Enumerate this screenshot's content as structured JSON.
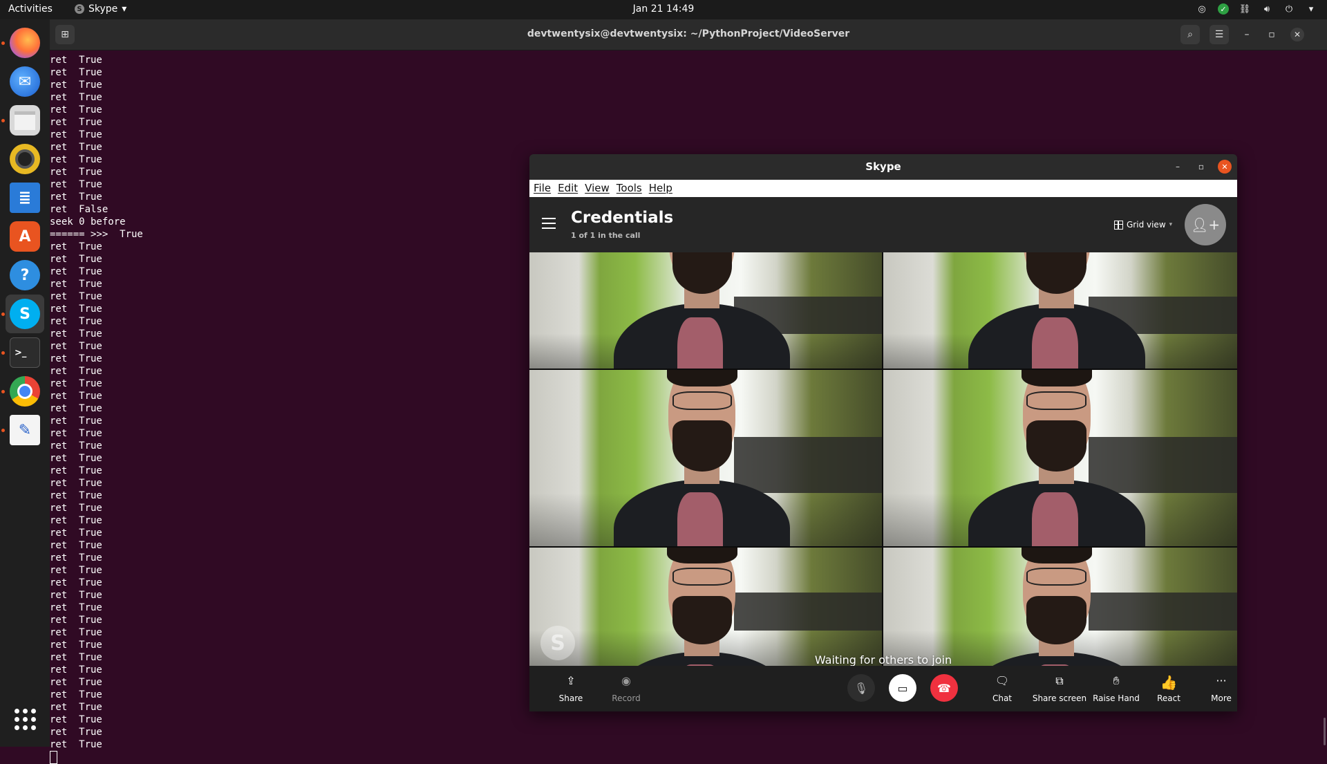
{
  "topbar": {
    "activities": "Activities",
    "app_name": "Skype",
    "clock": "Jan 21  14:49"
  },
  "terminal": {
    "title": "devtwentysix@devtwentysix: ~/PythonProject/VideoServer",
    "lines": [
      "ret  True",
      "ret  True",
      "ret  True",
      "ret  True",
      "ret  True",
      "ret  True",
      "ret  True",
      "ret  True",
      "ret  True",
      "ret  True",
      "ret  True",
      "ret  True",
      "ret  False",
      "seek 0 before",
      "====== >>>  True",
      "ret  True",
      "ret  True",
      "ret  True",
      "ret  True",
      "ret  True",
      "ret  True",
      "ret  True",
      "ret  True",
      "ret  True",
      "ret  True",
      "ret  True",
      "ret  True",
      "ret  True",
      "ret  True",
      "ret  True",
      "ret  True",
      "ret  True",
      "ret  True",
      "ret  True",
      "ret  True",
      "ret  True",
      "ret  True",
      "ret  True",
      "ret  True",
      "ret  True",
      "ret  True",
      "ret  True",
      "ret  True",
      "ret  True",
      "ret  True",
      "ret  True",
      "ret  True",
      "ret  True",
      "ret  True",
      "ret  True",
      "ret  True",
      "ret  True",
      "ret  True",
      "ret  True",
      "ret  True",
      "ret  True"
    ]
  },
  "skype": {
    "window_title": "Skype",
    "menu": [
      "File",
      "Edit",
      "View",
      "Tools",
      "Help"
    ],
    "conversation_title": "Credentials",
    "participants": "1 of 1 in the call",
    "view_mode": "Grid view",
    "waiting_text": "Waiting for others to join",
    "controls": {
      "share": "Share",
      "record": "Record",
      "chat": "Chat",
      "share_screen": "Share screen",
      "raise_hand": "Raise Hand",
      "react": "React",
      "more": "More"
    }
  },
  "colors": {
    "terminal_bg": "#300a24",
    "end_call": "#f0313f",
    "ubuntu_accent": "#e95420"
  }
}
